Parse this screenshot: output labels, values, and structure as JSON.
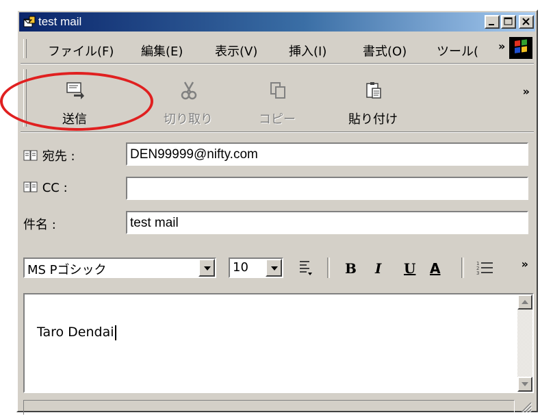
{
  "window": {
    "title": "test mail"
  },
  "menu": {
    "items": [
      "ファイル(F)",
      "編集(E)",
      "表示(V)",
      "挿入(I)",
      "書式(O)",
      "ツール("
    ],
    "overflow": "»"
  },
  "toolbar": {
    "send_label": "送信",
    "cut_label": "切り取り",
    "copy_label": "コピー",
    "paste_label": "貼り付け",
    "overflow": "»"
  },
  "fields": {
    "to_label": "宛先 :",
    "to_value": "DEN99999@nifty.com",
    "cc_label": "CC :",
    "cc_value": "",
    "subject_label": "件名 :",
    "subject_value": "test mail"
  },
  "format": {
    "font_name": "MS Pゴシック",
    "font_size": "10",
    "bold": "B",
    "italic": "I",
    "underline": "U",
    "font_color": "A",
    "overflow": "»"
  },
  "body": {
    "text": "Taro Dendai"
  },
  "colors": {
    "highlight": "#e02020",
    "titlebar": "#0a246a"
  }
}
